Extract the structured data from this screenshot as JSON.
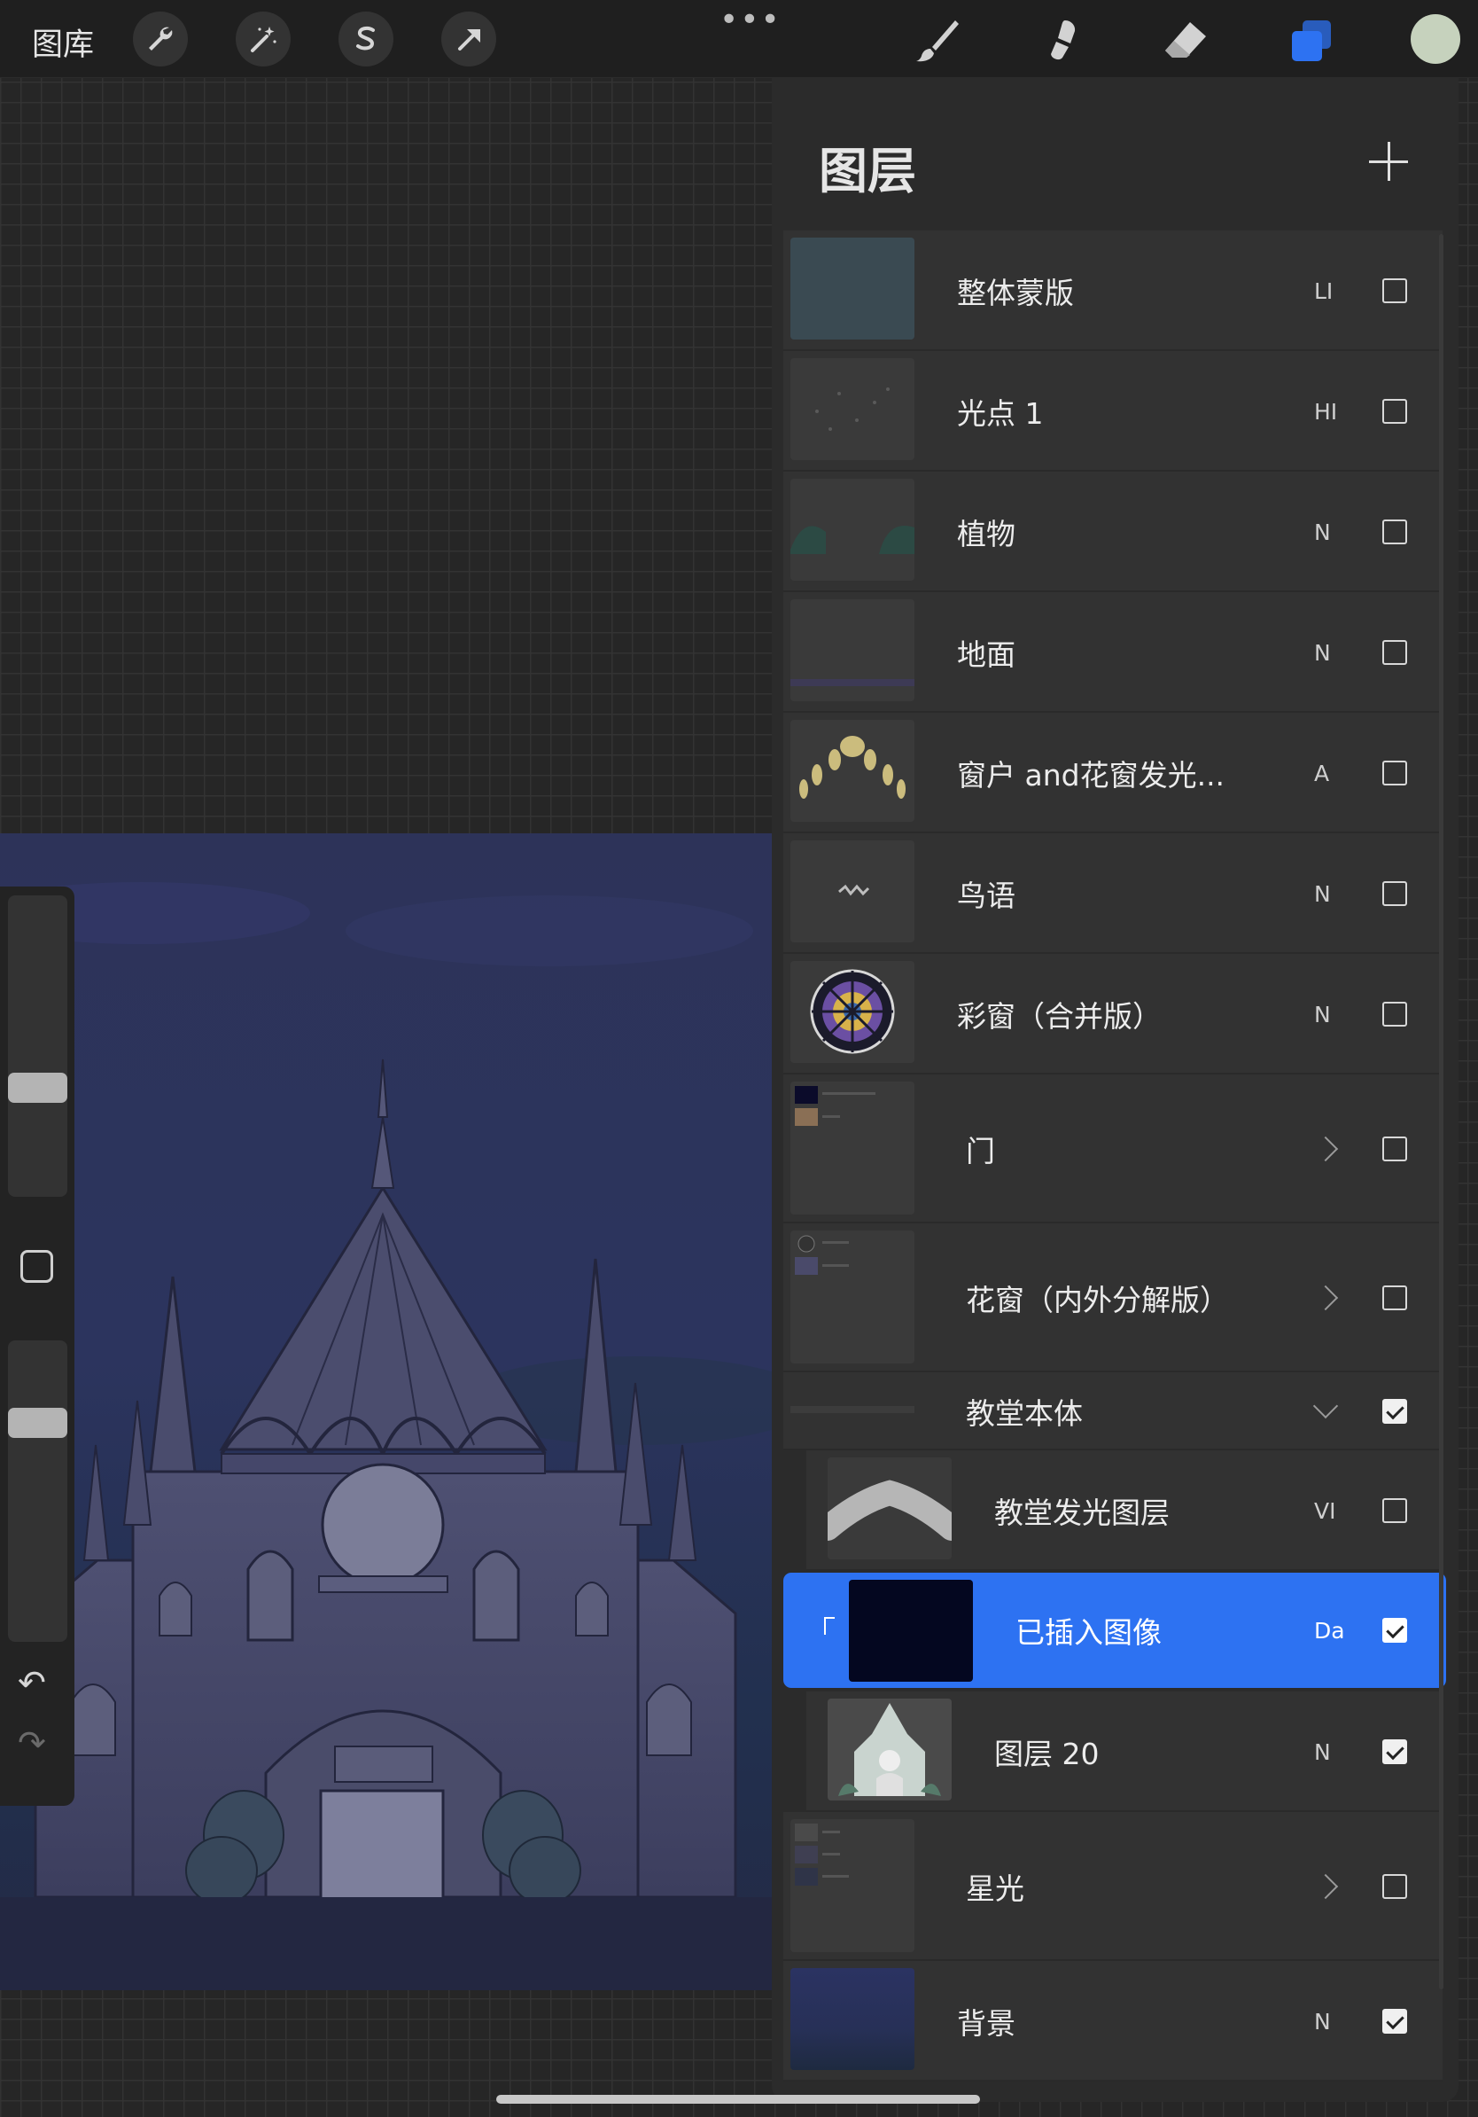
{
  "toolbar": {
    "gallery": "图库",
    "left_tools": [
      "wrench-icon",
      "magic-wand-icon",
      "selection-s-icon",
      "transform-arrow-icon"
    ],
    "more": "•••",
    "right_tools": [
      "brush-icon",
      "smudge-icon",
      "eraser-icon",
      "layers-icon"
    ],
    "current_color": "#c6d2bd"
  },
  "panel": {
    "title": "图层",
    "add_icon": "plus-icon",
    "layers": [
      {
        "name": "整体蒙版",
        "mode": "LI",
        "visible": false
      },
      {
        "name": "光点 1",
        "mode": "HI",
        "visible": false
      },
      {
        "name": "植物",
        "mode": "N",
        "visible": false
      },
      {
        "name": "地面",
        "mode": "N",
        "visible": false
      },
      {
        "name": "窗户 and花窗发光...",
        "mode": "A",
        "visible": false
      },
      {
        "name": "鸟语",
        "mode": "N",
        "visible": false
      },
      {
        "name": "彩窗（合并版）",
        "mode": "N",
        "visible": false
      },
      {
        "name": "门",
        "group": true,
        "collapsed": true,
        "visible": false
      },
      {
        "name": "花窗（内外分解版）",
        "group": true,
        "collapsed": true,
        "visible": false
      },
      {
        "name": "教堂本体",
        "group": true,
        "collapsed": false,
        "visible": true
      },
      {
        "name": "教堂发光图层",
        "mode": "VI",
        "visible": false
      },
      {
        "name": "已插入图像",
        "mode": "Da",
        "visible": true,
        "selected": true
      },
      {
        "name": "图层 20",
        "mode": "N",
        "visible": true
      },
      {
        "name": "星光",
        "group": true,
        "collapsed": true,
        "visible": false
      },
      {
        "name": "背景",
        "mode": "N",
        "visible": true
      }
    ]
  },
  "colors": {
    "accent": "#2d72f2",
    "panel": "#2b2b2b",
    "row": "#323232",
    "canvas_bg": "#262626"
  }
}
